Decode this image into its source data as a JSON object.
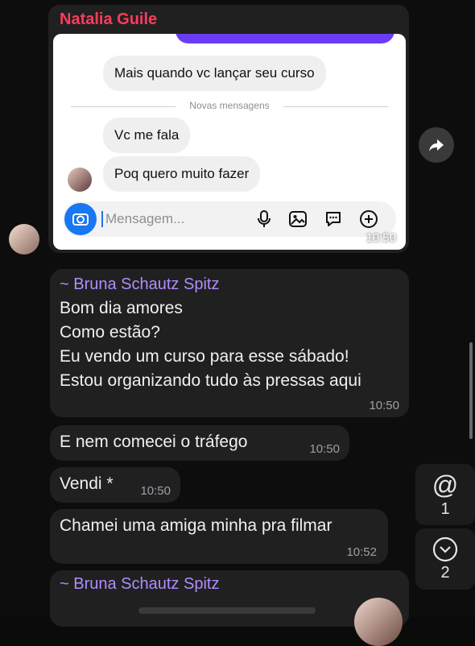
{
  "header": {
    "sender_name": "Natalia Guile"
  },
  "screenshot": {
    "messages": [
      "Mais quando vc lançar seu curso",
      "Vc me fala",
      "Poq quero muito fazer"
    ],
    "divider_label": "Novas mensagens",
    "composer_placeholder": "Mensagem...",
    "time": "10:50"
  },
  "messages": [
    {
      "sender": "~ Bruna Schautz Spitz",
      "lines": [
        "Bom dia amores",
        "Como estão?",
        "Eu vendo um curso para esse sábado!",
        "Estou organizando tudo às pressas aqui"
      ],
      "time": "10:50"
    },
    {
      "text": "E nem comecei o tráfego",
      "time": "10:50"
    },
    {
      "text": "Vendi *",
      "time": "10:50"
    },
    {
      "text": "Chamei uma amiga minha pra filmar",
      "time": "10:52"
    },
    {
      "sender": "~ Bruna Schautz Spitz"
    }
  ],
  "side": {
    "mentions_icon": "@",
    "mentions_count": "1",
    "unread_icon": "chevron-down",
    "unread_count": "2"
  },
  "colors": {
    "sender_primary": "#ff3b5c",
    "sender_secondary": "#b08cff",
    "bubble": "#202020",
    "background": "#0b0b0b",
    "instagram_camera": "#1877f2"
  }
}
